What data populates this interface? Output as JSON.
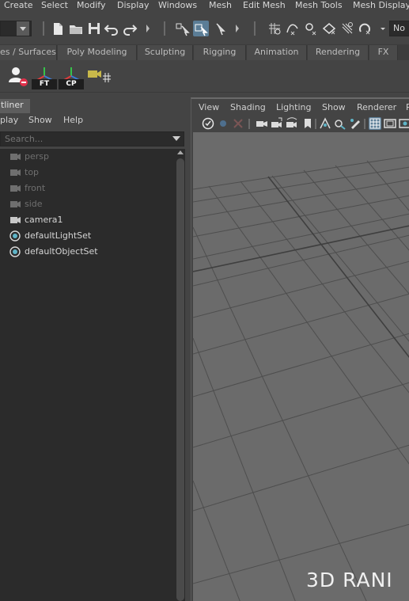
{
  "menubar": {
    "items": [
      "Create",
      "Select",
      "Modify",
      "Display",
      "Windows",
      "Mesh",
      "Edit Mesh",
      "Mesh Tools",
      "Mesh Display"
    ]
  },
  "statusline": {
    "selection_mask_label": "No"
  },
  "shelf": {
    "tabs": [
      "es / Surfaces",
      "Poly Modeling",
      "Sculpting",
      "Rigging",
      "Animation",
      "Rendering",
      "FX"
    ],
    "icons": [
      {
        "name": "user-icon",
        "label": ""
      },
      {
        "name": "freeze-transform-icon",
        "label": "FT"
      },
      {
        "name": "center-pivot-icon",
        "label": "CP"
      },
      {
        "name": "camera-aim-icon",
        "label": ""
      }
    ]
  },
  "outliner": {
    "tab_label": "tliner",
    "menu": [
      "play",
      "Show",
      "Help"
    ],
    "search_placeholder": "Search...",
    "items": [
      {
        "label": "persp",
        "type": "camera",
        "dim": true
      },
      {
        "label": "top",
        "type": "camera",
        "dim": true
      },
      {
        "label": "front",
        "type": "camera",
        "dim": true
      },
      {
        "label": "side",
        "type": "camera",
        "dim": true
      },
      {
        "label": "camera1",
        "type": "camera",
        "dim": false
      },
      {
        "label": "defaultLightSet",
        "type": "set",
        "dim": false
      },
      {
        "label": "defaultObjectSet",
        "type": "set",
        "dim": false
      }
    ]
  },
  "viewport": {
    "menu": [
      "View",
      "Shading",
      "Lighting",
      "Show",
      "Renderer",
      "P"
    ],
    "watermark": "3D RANI"
  },
  "colors": {
    "background": "#444444",
    "field": "#2b2b2b",
    "active_tool": "#5b7d96",
    "viewport_bg": "#6b6b6b",
    "grid_line": "#4a4a4a"
  }
}
